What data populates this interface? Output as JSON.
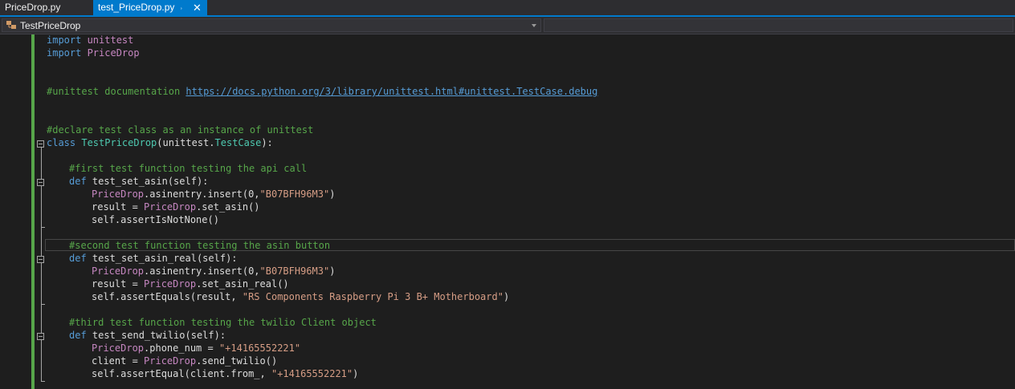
{
  "tabs": [
    {
      "label": "PriceDrop.py",
      "active": false
    },
    {
      "label": "test_PriceDrop.py",
      "active": true
    }
  ],
  "active_tab_pin_icon": "pin-icon",
  "active_tab_close_icon": "close-icon",
  "navbar": {
    "class_dropdown": "TestPriceDrop",
    "class_icon": "class-icon"
  },
  "code": {
    "l1_kw": "import",
    "l1_mod": " unittest",
    "l2_kw": "import",
    "l2_mod": " PriceDrop",
    "l3_comment": "#unittest documentation ",
    "l3_link": "https://docs.python.org/3/library/unittest.html#unittest.TestCase.debug",
    "l4_comment": "#declare test class as an instance of unittest",
    "l5_kw": "class",
    "l5_name": " TestPriceDrop",
    "l5_rest": "(unittest.",
    "l5_base": "TestCase",
    "l5_end": "):",
    "l6_comment": "#first test function testing the api call",
    "l7_kw": "def",
    "l7_rest": " test_set_asin(self):",
    "l8_mod": "PriceDrop",
    "l8_a": ".asinentry.insert(0,",
    "l8_str": "\"B07BFH96M3\"",
    "l8_b": ")",
    "l9_a": "result = ",
    "l9_mod": "PriceDrop",
    "l9_b": ".set_asin()",
    "l10": "self.assertIsNotNone()",
    "l11_comment": "#second test function testing the asin button",
    "l12_kw": "def",
    "l12_rest": " test_set_asin_real(self):",
    "l13_mod": "PriceDrop",
    "l13_a": ".asinentry.insert(0,",
    "l13_str": "\"B07BFH96M3\"",
    "l13_b": ")",
    "l14_a": "result = ",
    "l14_mod": "PriceDrop",
    "l14_b": ".set_asin_real()",
    "l15_a": "self.assertEquals(result, ",
    "l15_str": "\"RS Components Raspberry Pi 3 B+ Motherboard\"",
    "l15_b": ")",
    "l16_comment": "#third test function testing the twilio Client object",
    "l17_kw": "def",
    "l17_rest": " test_send_twilio(self):",
    "l18_mod": "PriceDrop",
    "l18_a": ".phone_num = ",
    "l18_str": "\"+14165552221\"",
    "l19_a": "client = ",
    "l19_mod": "PriceDrop",
    "l19_b": ".send_twilio()",
    "l20_a": "self.assertEqual(client.from_, ",
    "l20_str": "\"+14165552221\"",
    "l20_b": ")"
  },
  "colors": {
    "keyword": "#569cd6",
    "module": "#c586c0",
    "comment": "#57a64a",
    "class_name": "#4ec9b0",
    "string": "#d69d85",
    "accent": "#007acc"
  }
}
